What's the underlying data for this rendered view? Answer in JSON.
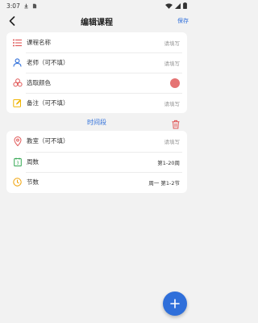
{
  "status_bar": {
    "time": "3:07"
  },
  "header": {
    "title": "编辑课程",
    "save_label": "保存"
  },
  "course_card": {
    "rows": [
      {
        "label": "课程名称",
        "value": "请填写",
        "icon": "list-icon",
        "color": "#e05757"
      },
      {
        "label": "老师（可不填）",
        "value": "请填写",
        "icon": "person-icon",
        "color": "#2f6fda"
      },
      {
        "label": "选取颜色",
        "value": "",
        "icon": "palette-icon",
        "color": "#e05757"
      },
      {
        "label": "备注（可不填）",
        "value": "请填写",
        "icon": "edit-note-icon",
        "color": "#f0b400"
      }
    ],
    "selected_color": "#e57373"
  },
  "time_section": {
    "title": "时间段",
    "rows": [
      {
        "label": "教室（可不填）",
        "value": "请填写",
        "icon": "location-icon",
        "color": "#e05757"
      },
      {
        "label": "周数",
        "value": "第1-20周",
        "icon": "calendar-icon",
        "color": "#34a853"
      },
      {
        "label": "节数",
        "value": "周一 第1-2节",
        "icon": "clock-icon",
        "color": "#f0a000"
      }
    ]
  },
  "colors": {
    "accent": "#2f6fda",
    "delete": "#e05757"
  }
}
